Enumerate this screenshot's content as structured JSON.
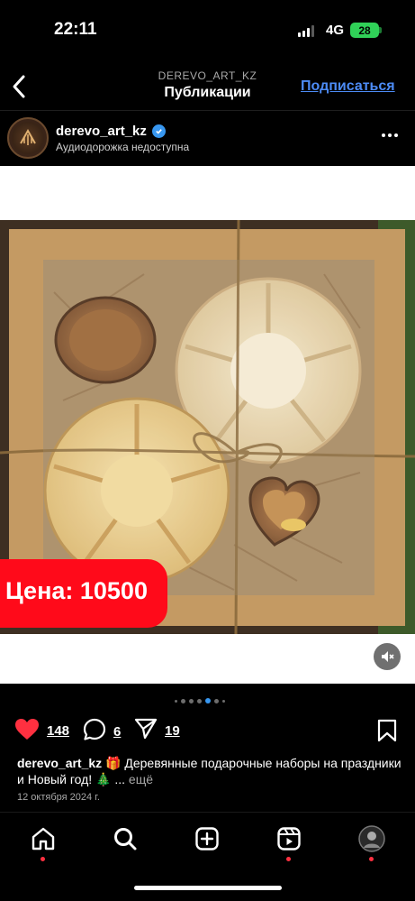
{
  "status_bar": {
    "time": "22:11",
    "network": "4G",
    "battery": "28"
  },
  "header": {
    "username": "DEREVO_ART_KZ",
    "title": "Публикации",
    "subscribe_label": "Подписаться"
  },
  "post": {
    "username": "derevo_art_kz",
    "subtitle": "Аудиодорожка недоступна",
    "price_overlay": "Цена: 10500",
    "likes": "148",
    "comments": "6",
    "shares": "19",
    "caption_username": "derevo_art_kz",
    "caption_text": " 🎁 Деревянные подарочные наборы на праздники и Новый год! 🎄 ... ",
    "caption_more": "ещё",
    "date": "12 октября 2024 г."
  },
  "carousel": {
    "count": 7,
    "active_index": 4
  },
  "icons": {
    "back": "chevron-left-icon",
    "verified": "verified-badge-icon",
    "more": "more-options-icon",
    "mute": "speaker-muted-icon",
    "like": "heart-icon",
    "comment": "comment-icon",
    "share": "send-icon",
    "save": "bookmark-icon",
    "nav": [
      "home-icon",
      "search-icon",
      "create-icon",
      "reels-icon",
      "profile-avatar"
    ]
  },
  "colors": {
    "accent": "#4c8bf5",
    "like": "#ff3040",
    "price_tag": "#ff0a1a",
    "battery": "#30d158"
  }
}
